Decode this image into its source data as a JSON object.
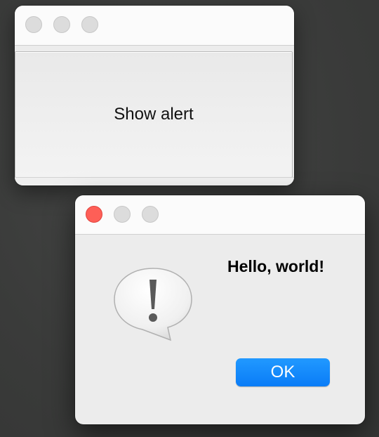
{
  "main_window": {
    "button_label": "Show alert"
  },
  "alert_window": {
    "message": "Hello, world!",
    "icon": "caution-bubble-icon",
    "ok_label": "OK"
  },
  "colors": {
    "close_button_active": "#fe5f57",
    "ok_button": "#0a7cf7",
    "desktop_background": "#3c3d3c"
  }
}
